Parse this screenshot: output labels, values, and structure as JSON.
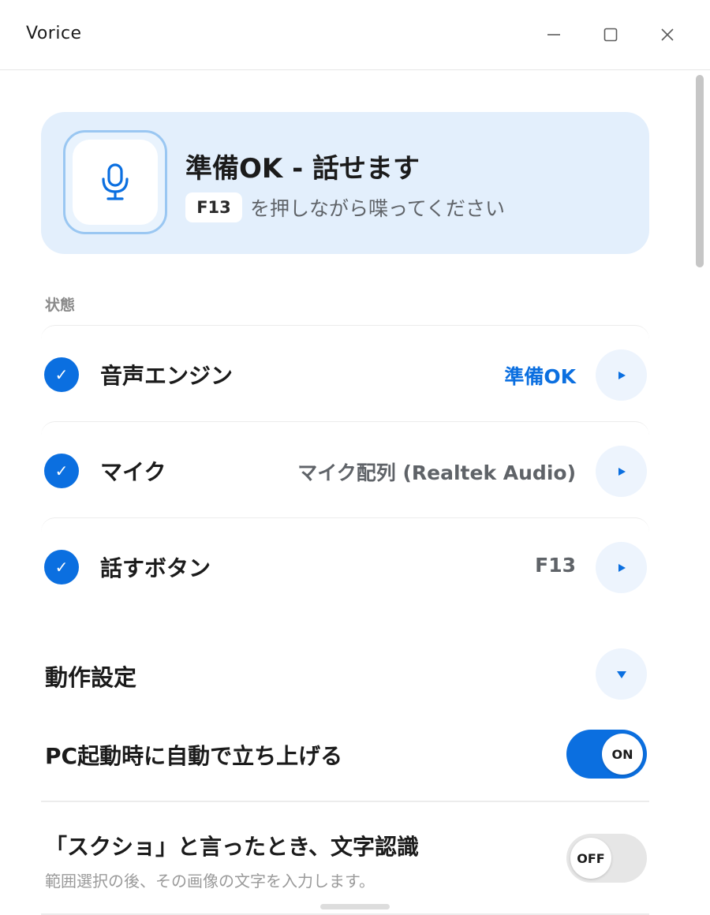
{
  "window": {
    "title": "Vorice",
    "controls": [
      "minimize-icon",
      "maximize-icon",
      "close-icon"
    ]
  },
  "hero": {
    "icon": "microphone-icon",
    "title": "準備OK - 話せます",
    "key": "F13",
    "hint": "を押しながら喋ってください"
  },
  "status": {
    "section_label": "状態",
    "rows": [
      {
        "label": "音声エンジン",
        "value": "準備OK",
        "value_color": "#0b6fe0"
      },
      {
        "label": "マイク",
        "value": "マイク配列 (Realtek Audio)",
        "value_color": "#5f6368"
      },
      {
        "label": "話すボタン",
        "value": "F13",
        "value_color": "#5f6368"
      }
    ]
  },
  "settings": {
    "title": "動作設定",
    "items": [
      {
        "label": "PC起動時に自動で立ち上げる",
        "state": "ON",
        "enabled": true
      },
      {
        "label": "「スクショ」と言ったとき、文字認識",
        "description": "範囲選択の後、その画像の文字を入力します。",
        "state": "OFF",
        "enabled": false
      }
    ]
  },
  "colors": {
    "accent": "#0b6fe0",
    "hero_bg": "#e3effc",
    "button_bg": "#edf4fd"
  }
}
